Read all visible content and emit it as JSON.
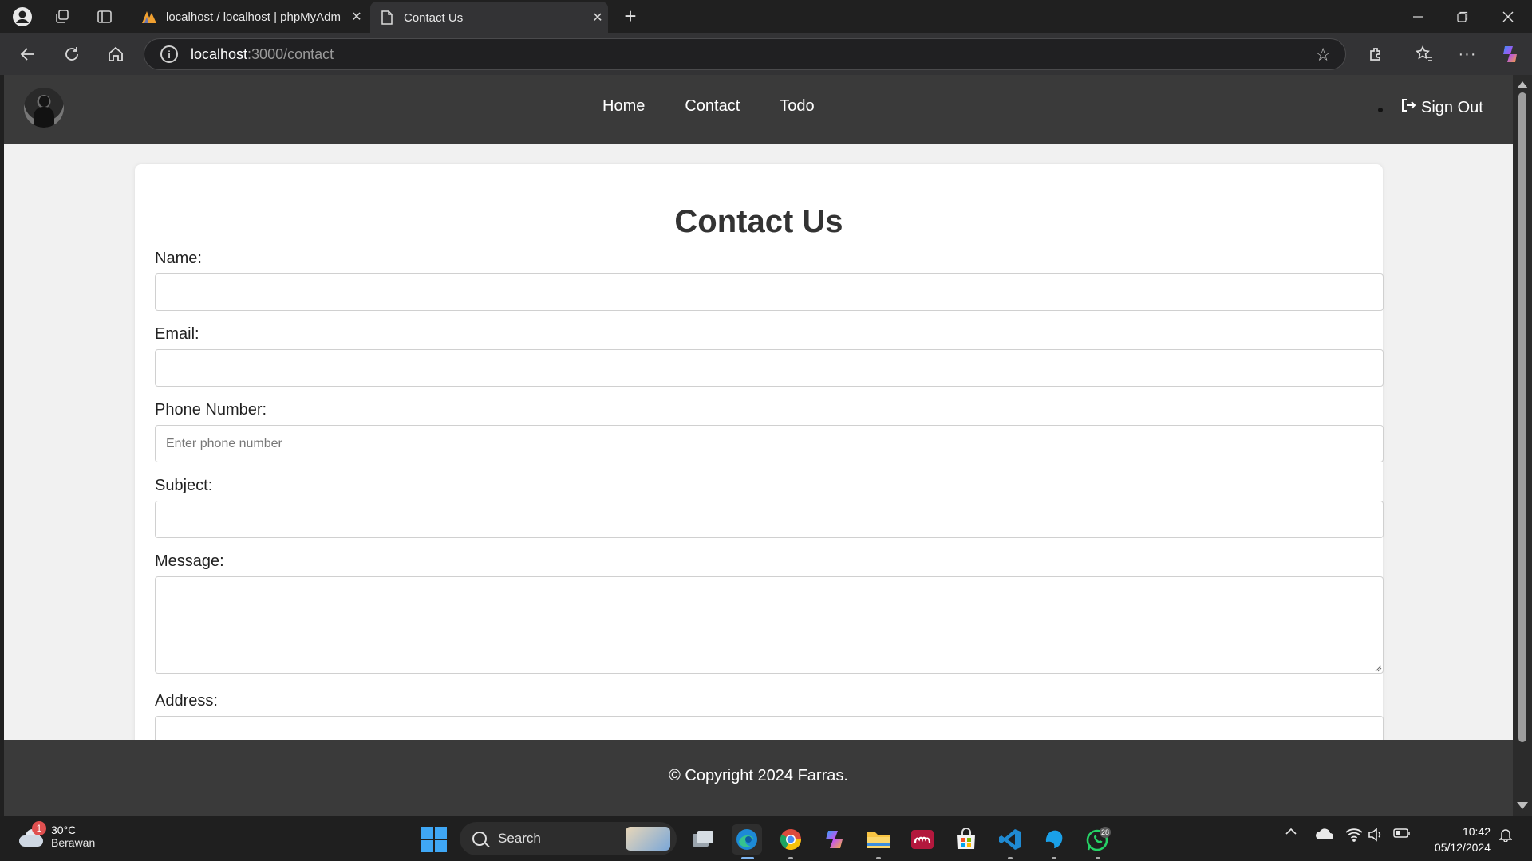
{
  "browser": {
    "tabs": [
      {
        "title": "localhost / localhost | phpMyAdm",
        "close": "✕"
      },
      {
        "title": "Contact Us",
        "close": "✕"
      }
    ],
    "new_tab": "+",
    "url_host": "localhost",
    "url_path": ":3000/contact"
  },
  "site": {
    "nav": [
      "Home",
      "Contact",
      "Todo"
    ],
    "signout": "Sign Out",
    "heading": "Contact Us",
    "form": {
      "name_label": "Name:",
      "email_label": "Email:",
      "phone_label": "Phone Number:",
      "phone_placeholder": "Enter phone number",
      "subject_label": "Subject:",
      "message_label": "Message:",
      "address_label": "Address:"
    },
    "footer": "© Copyright 2024 Farras."
  },
  "taskbar": {
    "weather_badge": "1",
    "temperature": "30°C",
    "condition": "Berawan",
    "search": "Search",
    "whatsapp_badge": "28",
    "time": "10:42",
    "date": "05/12/2024"
  },
  "colors": {
    "nav_bg": "#3a3a3a",
    "page_bg": "#f1f1f1",
    "card_bg": "#ffffff",
    "windows_accent": "#3fa7f5"
  }
}
